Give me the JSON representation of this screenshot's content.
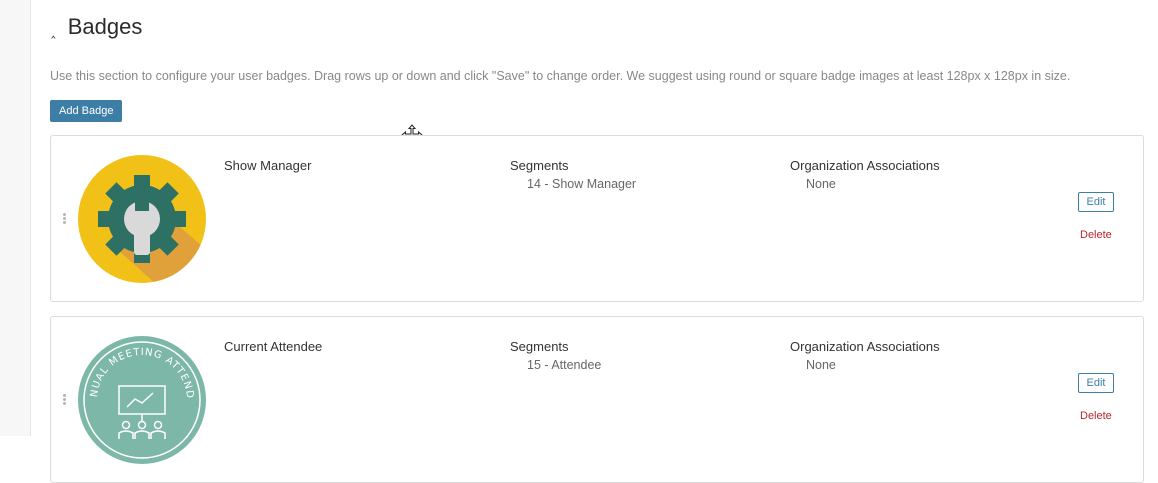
{
  "section": {
    "title": "Badges",
    "description": "Use this section to configure your user badges. Drag rows up or down and click \"Save\" to change order. We suggest using round or square badge images at least 128px x 128px in size.",
    "add_button_label": "Add Badge"
  },
  "columns": {
    "segments_label": "Segments",
    "org_label": "Organization Associations"
  },
  "badges": [
    {
      "name": "Show Manager",
      "segment": "14 - Show Manager",
      "org": "None",
      "edit_label": "Edit",
      "delete_label": "Delete",
      "icon": "gear-wrench-icon",
      "colors": {
        "circle": "#f2c118",
        "gear": "#2f7065",
        "shadow": "#e0a13a"
      }
    },
    {
      "name": "Current Attendee",
      "segment": "15 - Attendee",
      "org": "None",
      "edit_label": "Edit",
      "delete_label": "Delete",
      "icon": "meeting-attendee-icon",
      "ring_text": "ANNUAL MEETING ATTENDEE",
      "colors": {
        "circle": "#7db7a8"
      }
    }
  ],
  "colors": {
    "accent": "#3d7ea6",
    "delete": "#b5272d"
  }
}
